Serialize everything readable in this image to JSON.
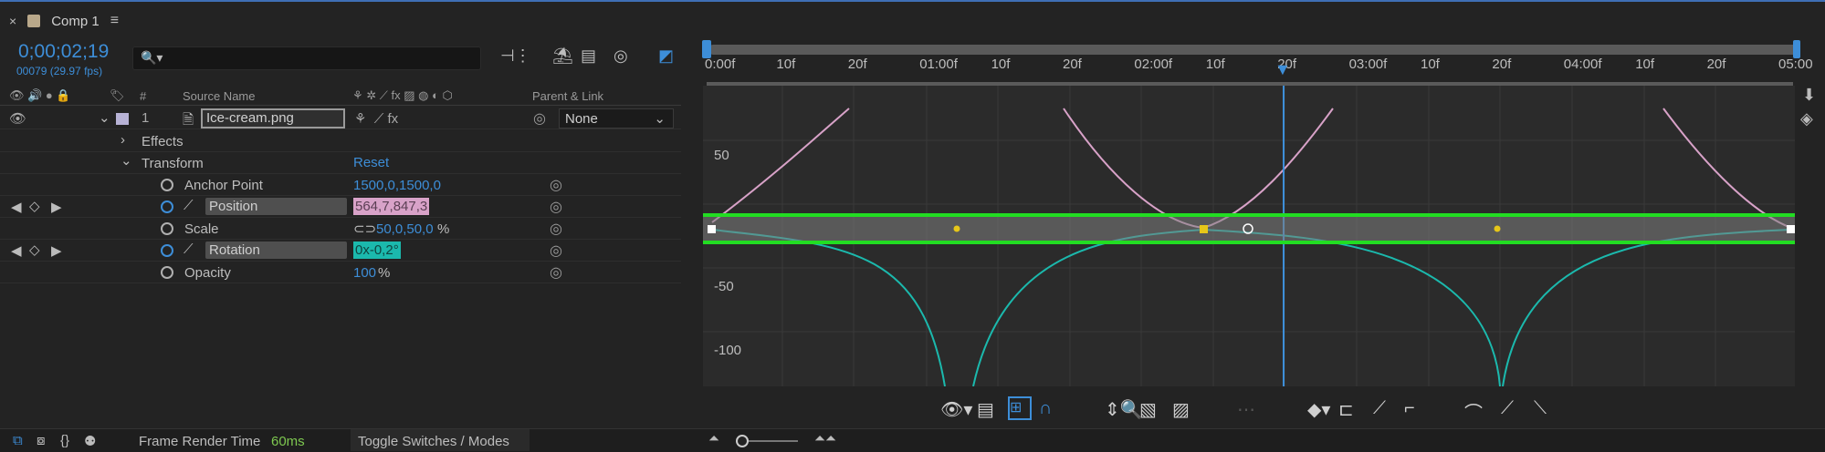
{
  "colors": {
    "accent": "#3d8ed8",
    "position_curve": "#d8a2c8",
    "rotation_curve": "#1bb9ad",
    "keyframe": "#e6c619",
    "highlight_box": "#22dd22"
  },
  "tab": {
    "title": "Comp 1",
    "close": "×",
    "menu": "≡"
  },
  "timecode": {
    "current": "0;00;02;19",
    "frames": "00079 (29.97 fps)"
  },
  "search": {
    "icon": "🔍▾",
    "placeholder": ""
  },
  "columns": {
    "label_num": "#",
    "source_name": "Source Name",
    "switches": "⚘ ✲ ⟋ fx ▨ ◍ ◐ ⬡",
    "parent": "Parent & Link"
  },
  "layer": {
    "num": "1",
    "name": "Ice-cream.png",
    "parent": "None"
  },
  "properties": {
    "effects": "Effects",
    "transform": "Transform",
    "reset": "Reset",
    "anchor_label": "Anchor Point",
    "anchor_value": "1500,0,1500,0",
    "position_label": "Position",
    "position_value": "564,7,847,3",
    "scale_label": "Scale",
    "scale_value": "50,0,50,0",
    "scale_unit": "%",
    "rotation_label": "Rotation",
    "rotation_value": "0x-0,2°",
    "opacity_label": "Opacity",
    "opacity_value": "100",
    "opacity_unit": "%"
  },
  "ruler": {
    "ticks": [
      "0:00f",
      "10f",
      "20f",
      "01:00f",
      "10f",
      "20f",
      "02:00f",
      "10f",
      "20f",
      "03:00f",
      "10f",
      "20f",
      "04:00f",
      "10f",
      "20f",
      "05:00"
    ]
  },
  "graph": {
    "y_labels": [
      "50",
      "-50",
      "-100"
    ]
  },
  "bottom": {
    "frame_render_label": "Frame Render Time",
    "frame_render_value": "60ms",
    "toggle": "Toggle Switches / Modes"
  }
}
